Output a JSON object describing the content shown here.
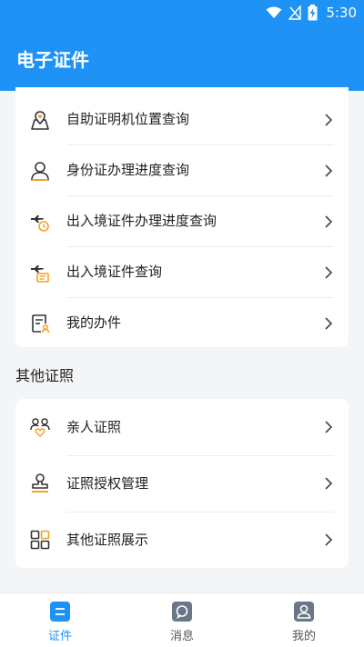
{
  "status_bar": {
    "time": "5:30"
  },
  "header": {
    "title": "电子证件"
  },
  "top_list": [
    {
      "label": "自助证明机位置查询",
      "icon": "map-pin-icon"
    },
    {
      "label": "身份证办理进度查询",
      "icon": "person-icon"
    },
    {
      "label": "出入境证件办理进度查询",
      "icon": "plane-clock-icon"
    },
    {
      "label": "出入境证件查询",
      "icon": "plane-doc-icon"
    },
    {
      "label": "我的办件",
      "icon": "document-user-icon"
    }
  ],
  "section": {
    "title": "其他证照"
  },
  "other_list": [
    {
      "label": "亲人证照",
      "icon": "family-heart-icon"
    },
    {
      "label": "证照授权管理",
      "icon": "stamp-icon"
    },
    {
      "label": "其他证照展示",
      "icon": "grid-icon"
    }
  ],
  "tabs": [
    {
      "label": "证件",
      "icon": "id-card-icon",
      "active": true
    },
    {
      "label": "消息",
      "icon": "message-icon",
      "active": false
    },
    {
      "label": "我的",
      "icon": "profile-icon",
      "active": false
    }
  ],
  "colors": {
    "primary": "#1f93f5",
    "accent": "#f2a22b",
    "background": "#f4f5f7"
  }
}
